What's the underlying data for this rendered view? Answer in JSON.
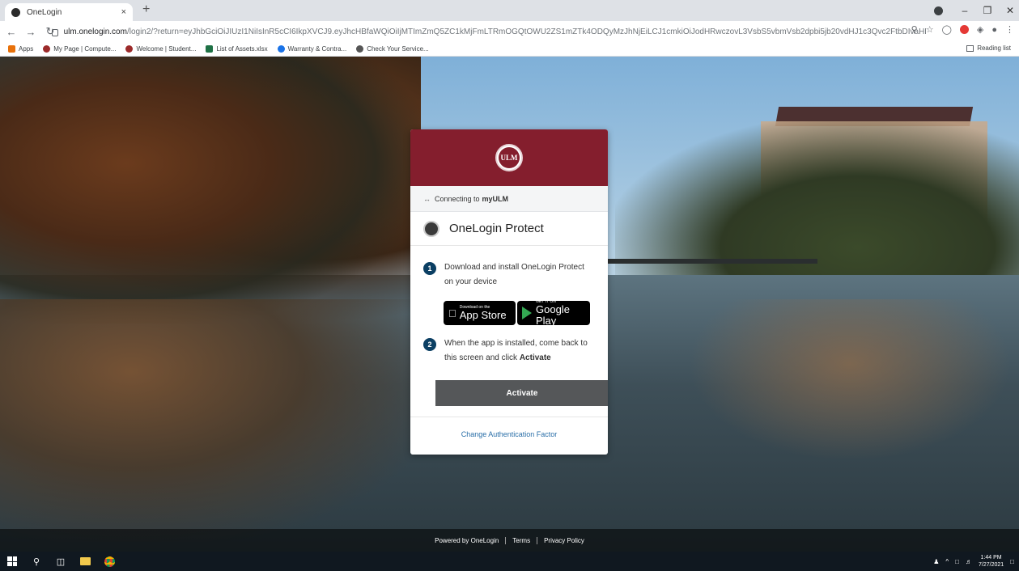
{
  "browser": {
    "tab_title": "OneLogin",
    "tab_close": "×",
    "new_tab": "+",
    "url_host": "ulm.onelogin.com",
    "url_rest": "/login2/?return=eyJhbGciOiJIUzI1NiIsInR5cCI6IkpXVCJ9.eyJhcHBfaWQiOiIjMTImZmQ5ZC1kMjFmLTRmOGQtOWU2ZS1mZTk4ODQyMzJhNjEiLCJ1cmkiOiJodHRwczovL3VsbS5vbmVsb2dpbi5jb20vdHJ1c3Qvc2FtbDIvaHR0cC1wb3N0L...",
    "bookmarks": [
      {
        "label": "Apps",
        "color": "#e8710a"
      },
      {
        "label": "My Page | Compute...",
        "color": "#9c2a2a"
      },
      {
        "label": "Welcome | Student...",
        "color": "#9c2a2a"
      },
      {
        "label": "List of Assets.xlsx",
        "color": "#1e7145"
      },
      {
        "label": "Warranty & Contra...",
        "color": "#1a73e8"
      },
      {
        "label": "Check Your Service...",
        "color": "#555555"
      }
    ],
    "reading_list": "Reading list"
  },
  "card": {
    "connecting_prefix": "Connecting to",
    "connecting_app": "myULM",
    "seal_text": "ULM",
    "factor_title": "OneLogin Protect",
    "step1_num": "1",
    "step1_text": "Download and install OneLogin Protect on your device",
    "appstore_small": "Download on the",
    "appstore_big": "App Store",
    "gplay_small": "GET IT ON",
    "gplay_big": "Google Play",
    "step2_num": "2",
    "step2_text": "When the app is installed, come back to this screen and click",
    "step2_bold": "Activate",
    "activate_label": "Activate",
    "change_link": "Change Authentication Factor"
  },
  "footer": {
    "powered": "Powered by OneLogin",
    "terms": "Terms",
    "privacy": "Privacy Policy"
  },
  "taskbar": {
    "time": "1:44 PM",
    "date": "7/27/2021"
  },
  "colors": {
    "brand": "#841e2d",
    "step_badge": "#0b3f63",
    "activate_bg": "#555759",
    "link": "#2a6fa8"
  }
}
